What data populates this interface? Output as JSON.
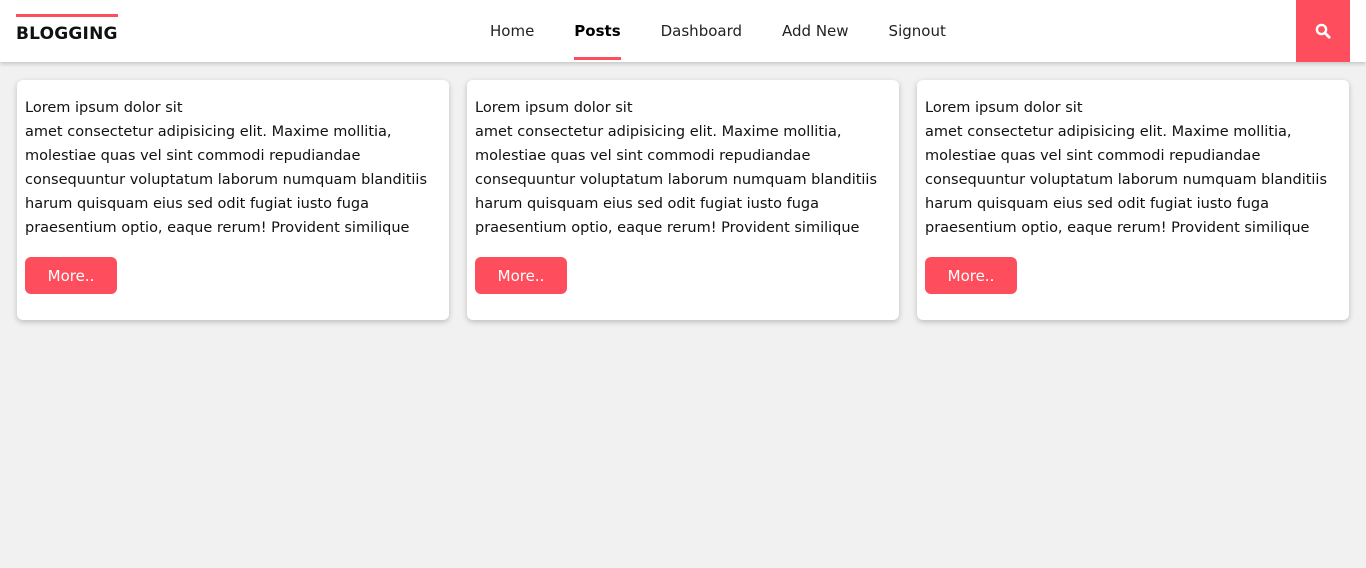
{
  "header": {
    "brand": "BLOGGING",
    "nav": [
      {
        "label": "Home",
        "active": false
      },
      {
        "label": "Posts",
        "active": true
      },
      {
        "label": "Dashboard",
        "active": false
      },
      {
        "label": "Add New",
        "active": false
      },
      {
        "label": "Signout",
        "active": false
      }
    ],
    "search_icon": "search-icon"
  },
  "colors": {
    "accent": "#fe4d5c",
    "background": "#f1f1f1",
    "card": "#ffffff"
  },
  "posts": [
    {
      "title": "Lorem ipsum dolor sit",
      "body": "amet consectetur adipisicing elit. Maxime mollitia, molestiae quas vel sint commodi repudiandae consequuntur voluptatum laborum numquam blanditiis harum quisquam eius sed odit fugiat iusto fuga praesentium optio, eaque rerum! Provident similique accusanti",
      "button": "More.."
    },
    {
      "title": "Lorem ipsum dolor sit",
      "body": "amet consectetur adipisicing elit. Maxime mollitia, molestiae quas vel sint commodi repudiandae consequuntur voluptatum laborum numquam blanditiis harum quisquam eius sed odit fugiat iusto fuga praesentium optio, eaque rerum! Provident similique accusanti",
      "button": "More.."
    },
    {
      "title": "Lorem ipsum dolor sit",
      "body": "amet consectetur adipisicing elit. Maxime mollitia, molestiae quas vel sint commodi repudiandae consequuntur voluptatum laborum numquam blanditiis harum quisquam eius sed odit fugiat iusto fuga praesentium optio, eaque rerum! Provident similique accusanti",
      "button": "More.."
    }
  ]
}
